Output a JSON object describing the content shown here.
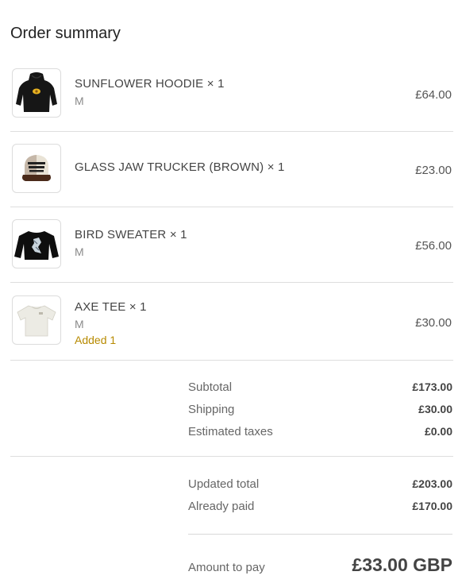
{
  "title": "Order summary",
  "items": [
    {
      "name": "SUNFLOWER HOODIE × 1",
      "variant": "M",
      "added": "",
      "price": "£64.00",
      "image_icon": "hoodie-icon"
    },
    {
      "name": "GLASS JAW TRUCKER (BROWN) × 1",
      "variant": "",
      "added": "",
      "price": "£23.00",
      "image_icon": "trucker-cap-icon"
    },
    {
      "name": "BIRD SWEATER × 1",
      "variant": "M",
      "added": "",
      "price": "£56.00",
      "image_icon": "sweater-icon"
    },
    {
      "name": "AXE TEE × 1",
      "variant": "M",
      "added": "Added 1",
      "price": "£30.00",
      "image_icon": "tshirt-icon"
    }
  ],
  "totals": {
    "subtotal_label": "Subtotal",
    "subtotal_value": "£173.00",
    "shipping_label": "Shipping",
    "shipping_value": "£30.00",
    "taxes_label": "Estimated taxes",
    "taxes_value": "£0.00"
  },
  "updated": {
    "updated_total_label": "Updated total",
    "updated_total_value": "£203.00",
    "already_paid_label": "Already paid",
    "already_paid_value": "£170.00"
  },
  "amount_to_pay": {
    "label": "Amount to pay",
    "value": "£33.00 GBP"
  },
  "colors": {
    "added_text": "#b78a00",
    "divider": "#dedede"
  }
}
